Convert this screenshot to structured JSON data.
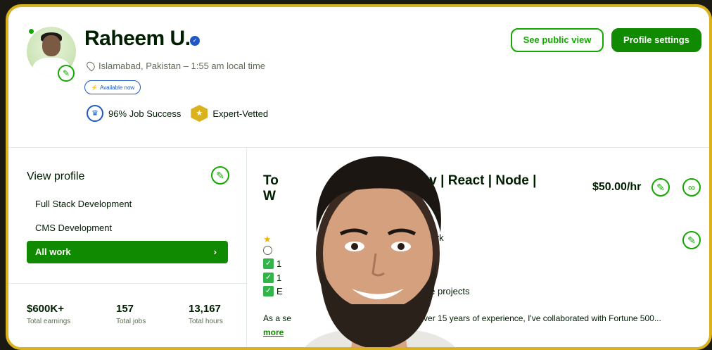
{
  "profile": {
    "name": "Raheem U.",
    "location": "Islamabad, Pakistan – 1:55 am local time",
    "availability": "Available now",
    "job_success": "96% Job Success",
    "expert_vetted": "Expert-Vetted"
  },
  "header": {
    "public_view_label": "See public view",
    "settings_label": "Profile settings"
  },
  "sidebar": {
    "view_profile_label": "View profile",
    "items": [
      {
        "label": "Full Stack Development"
      },
      {
        "label": "CMS Development"
      },
      {
        "label": "All work"
      }
    ]
  },
  "totals": [
    {
      "value": "$600K+",
      "label": "Total earnings"
    },
    {
      "value": "157",
      "label": "Total jobs"
    },
    {
      "value": "13,167",
      "label": "Total hours"
    }
  ],
  "main": {
    "title_left": "To",
    "title_left_2": "W",
    "title_right": "Dev | React | Node |",
    "rate": "$50.00/hr",
    "frag_upwork": "pwork",
    "frag_1": "1",
    "frag_2": "1",
    "frag_3": "E",
    "frag_scale": "scale projects",
    "desc_left": "As a se",
    "desc_right": "th over 15 years of experience, I've collaborated with Fortune 500...",
    "more_label": "more"
  },
  "icons": {
    "verified": "verified-badge-icon",
    "location": "location-pin-icon",
    "bolt": "bolt-icon",
    "job_success": "crown-icon",
    "expert": "expert-badge-icon",
    "edit": "pencil-icon",
    "link": "link-icon",
    "chevron": "chevron-right-icon"
  },
  "colors": {
    "brand_green": "#108a00",
    "accent_blue": "#1f57c3",
    "frame_gold": "#d9b21e"
  }
}
